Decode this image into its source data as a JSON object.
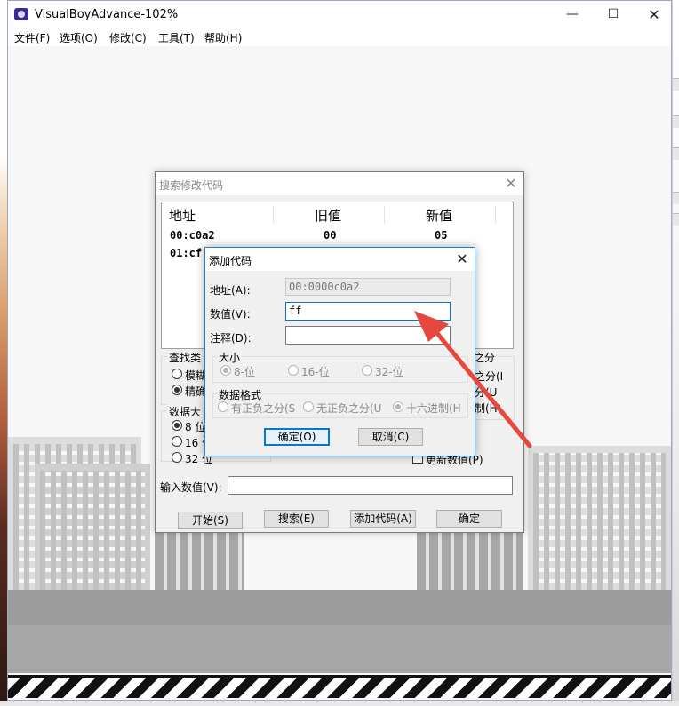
{
  "window": {
    "title": "VisualBoyAdvance-102%",
    "minimize_glyph": "—",
    "maximize_glyph": "☐",
    "close_glyph": "✕"
  },
  "menu": [
    "文件(F)",
    "选项(O)",
    "修改(C)",
    "工具(T)",
    "帮助(H)"
  ],
  "search_dialog": {
    "title": "搜索修改代码",
    "close_glyph": "✕",
    "columns": [
      "地址",
      "旧值",
      "新值"
    ],
    "rows": [
      {
        "address": "00:c0a2",
        "old": "00",
        "new": "05"
      },
      {
        "address": "01:cf",
        "old": "",
        "new": ""
      }
    ],
    "search_type_label": "查找类",
    "search_type_options": [
      "模糊",
      "精确"
    ],
    "search_type_selected": 1,
    "data_size_label": "数据大",
    "data_size_options": [
      "8 位",
      "16 位",
      "32 位"
    ],
    "data_size_selected": 0,
    "right_group_label": "之分",
    "right_options": [
      "之分(I",
      "分(U",
      "制(H)"
    ],
    "update_values_label": "更新数值(P)",
    "input_label": "输入数值(V):",
    "input_value": "",
    "buttons": [
      "开始(S)",
      "搜索(E)",
      "添加代码(A)",
      "确定"
    ]
  },
  "add_code_dialog": {
    "title": "添加代码",
    "close_glyph": "✕",
    "address_label": "地址(A):",
    "address_value": "00:0000c0a2",
    "value_label": "数值(V):",
    "value_value": "ff",
    "note_label": "注释(D):",
    "note_value": "",
    "size_group_label": "大小",
    "size_options": [
      "8-位",
      "16-位",
      "32-位"
    ],
    "size_selected": 0,
    "format_group_label": "数据格式",
    "format_options": [
      "有正负之分(S",
      "无正负之分(U",
      "十六进制(H"
    ],
    "format_selected": 2,
    "ok_label": "确定(O)",
    "cancel_label": "取消(C)"
  },
  "colors": {
    "annotation_arrow": "#e8473d",
    "focus_border": "#0078d7"
  }
}
